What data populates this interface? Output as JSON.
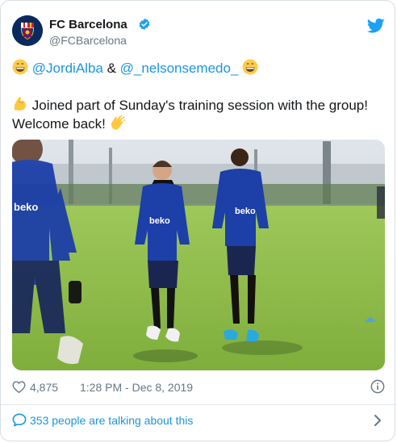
{
  "tweet": {
    "author_name": "FC Barcelona",
    "author_handle": "@FCBarcelona",
    "mention_1": "@JordiAlba",
    "mention_sep": " & ",
    "mention_2": "@_nelsonsemedo_",
    "text_line_1": "Joined part of Sunday's training session with the group!",
    "text_line_2": "Welcome back!",
    "photo_shirt_text": "beko",
    "likes": "4,875",
    "timestamp": "1:28 PM - Dec 8, 2019",
    "talking": "353 people are talking about this"
  },
  "colors": {
    "link": "#1b95e0",
    "secondary": "#657786",
    "club_navy": "#0a2a5e",
    "pitch": "#8fbc45"
  },
  "icons": [
    "fcb-crest-icon",
    "verified-badge-icon",
    "twitter-bird-icon",
    "grinning-emoji-icon",
    "flexed-biceps-emoji-icon",
    "clapping-hands-emoji-icon",
    "heart-icon",
    "info-icon",
    "speech-bubble-icon",
    "chevron-right-icon"
  ]
}
